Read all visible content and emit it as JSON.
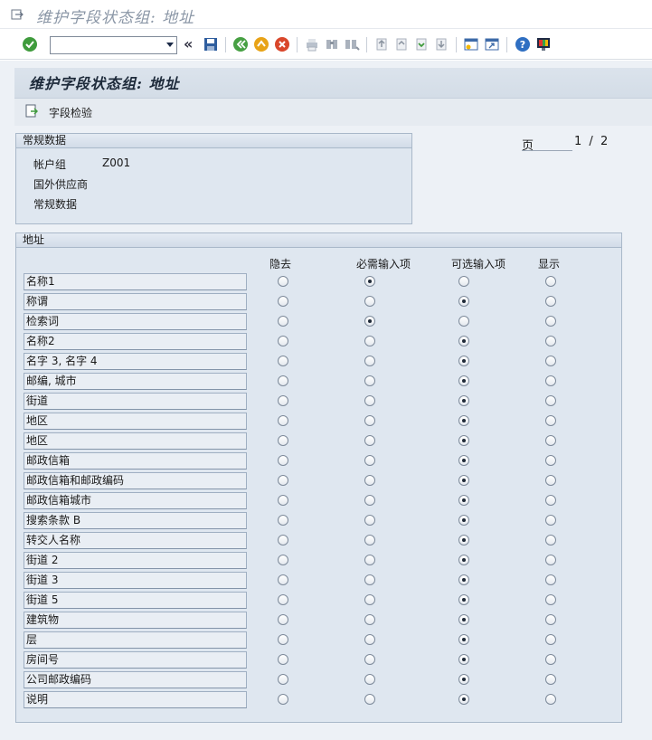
{
  "window": {
    "title": "维护字段状态组: 地址"
  },
  "toolbar": {
    "command_value": "",
    "icons": [
      "enter-check-icon",
      "command-field",
      "collapse-icon",
      "save-icon",
      "back-icon",
      "exit-icon",
      "cancel-icon",
      "print-icon",
      "find-icon",
      "find-next-icon",
      "first-page-icon",
      "previous-page-icon",
      "next-page-icon",
      "last-page-icon",
      "create-session-icon",
      "shortcut-icon",
      "help-icon",
      "customize-layout-icon"
    ]
  },
  "page": {
    "title": "维护字段状态组: 地址",
    "field_check_label": "字段检验"
  },
  "general": {
    "group_title": "常规数据",
    "account_group_label": "帐户组",
    "account_group_value": "Z001",
    "foreign_vendor_label": "国外供应商",
    "general_data_label": "常规数据"
  },
  "pager": {
    "label": "页",
    "current": "1",
    "separator": "/",
    "total": "2"
  },
  "address": {
    "group_title": "地址",
    "columns": [
      "隐去",
      "必需输入项",
      "可选输入项",
      "显示"
    ],
    "rows": [
      {
        "label": "名称1",
        "selected": 1
      },
      {
        "label": "称谓",
        "selected": 2
      },
      {
        "label": "检索词",
        "selected": 1
      },
      {
        "label": "名称2",
        "selected": 2
      },
      {
        "label": "名字 3, 名字 4",
        "selected": 2
      },
      {
        "label": "邮编, 城市",
        "selected": 2
      },
      {
        "label": "街道",
        "selected": 2
      },
      {
        "label": "地区",
        "selected": 2
      },
      {
        "label": "地区",
        "selected": 2
      },
      {
        "label": "邮政信箱",
        "selected": 2
      },
      {
        "label": "邮政信箱和邮政编码",
        "selected": 2
      },
      {
        "label": "邮政信箱城市",
        "selected": 2
      },
      {
        "label": "搜索条款 B",
        "selected": 2
      },
      {
        "label": "转交人名称",
        "selected": 2
      },
      {
        "label": "街道 2",
        "selected": 2
      },
      {
        "label": "街道 3",
        "selected": 2
      },
      {
        "label": "街道 5",
        "selected": 2
      },
      {
        "label": "建筑物",
        "selected": 2
      },
      {
        "label": "层",
        "selected": 2
      },
      {
        "label": "房间号",
        "selected": 2
      },
      {
        "label": "公司邮政编码",
        "selected": 2
      },
      {
        "label": "说明",
        "selected": 2
      }
    ]
  }
}
